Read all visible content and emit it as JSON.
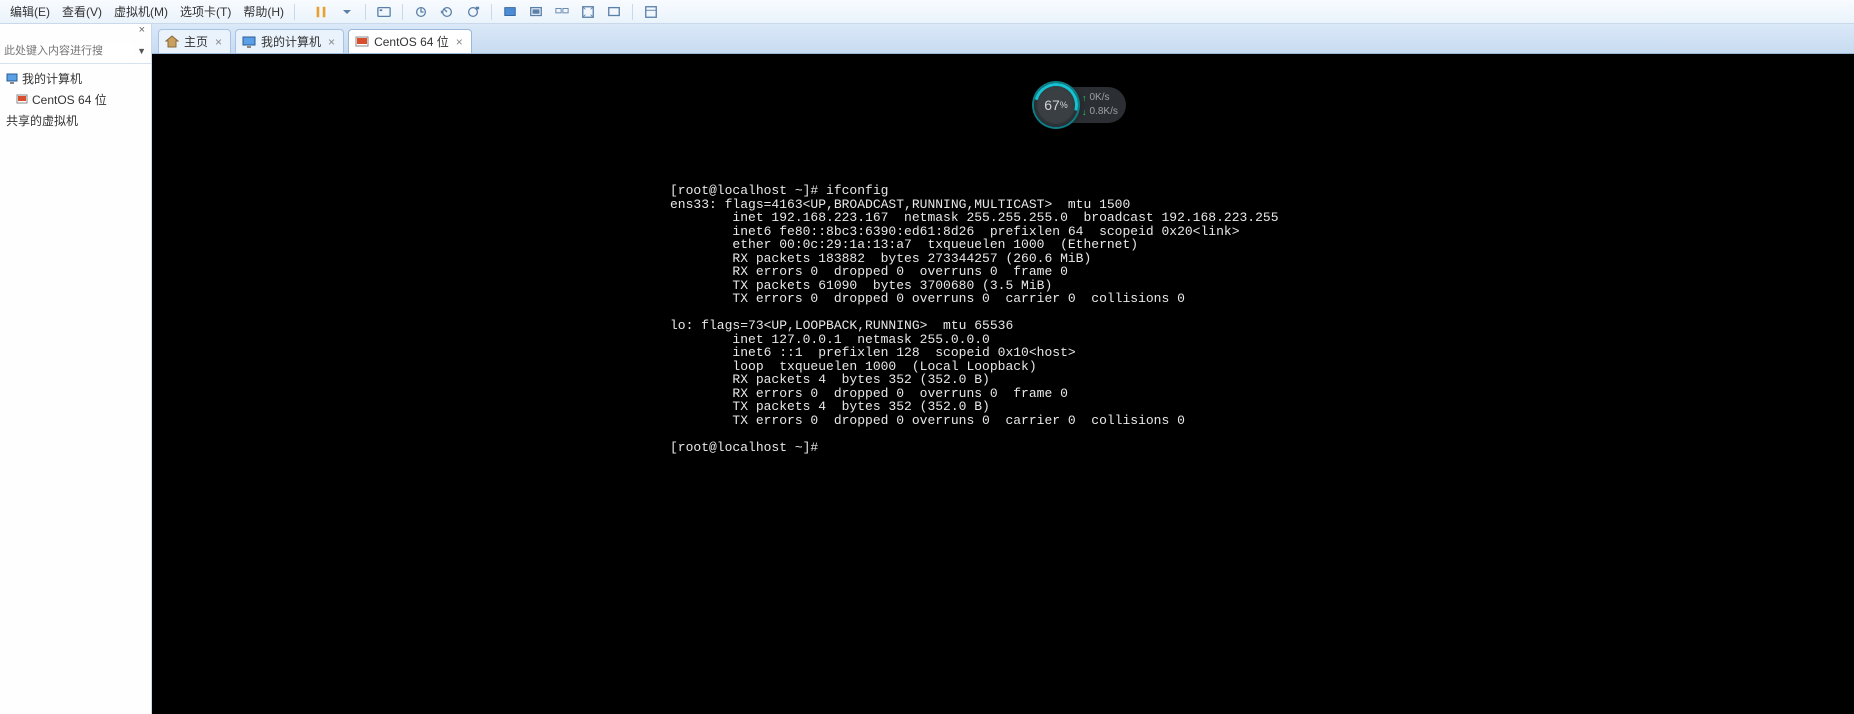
{
  "menu": {
    "edit": "编辑(E)",
    "view": "查看(V)",
    "vm": "虚拟机(M)",
    "tabs": "选项卡(T)",
    "help": "帮助(H)"
  },
  "sidebar": {
    "close_x": "×",
    "search_placeholder": "此处键入内容进行搜",
    "items": {
      "my_computer": "我的计算机",
      "centos": "CentOS 64 位",
      "shared": "共享的虚拟机"
    }
  },
  "tabs": [
    {
      "label": "主页",
      "icon": "home"
    },
    {
      "label": "我的计算机",
      "icon": "monitor"
    },
    {
      "label": "CentOS 64 位",
      "icon": "vm",
      "active": true
    }
  ],
  "perf": {
    "percent": "67",
    "pct_sym": "%",
    "up": "0K/s",
    "down": "0.8K/s"
  },
  "terminal": {
    "lines": [
      "[root@localhost ~]# ifconfig",
      "ens33: flags=4163<UP,BROADCAST,RUNNING,MULTICAST>  mtu 1500",
      "        inet 192.168.223.167  netmask 255.255.255.0  broadcast 192.168.223.255",
      "        inet6 fe80::8bc3:6390:ed61:8d26  prefixlen 64  scopeid 0x20<link>",
      "        ether 00:0c:29:1a:13:a7  txqueuelen 1000  (Ethernet)",
      "        RX packets 183882  bytes 273344257 (260.6 MiB)",
      "        RX errors 0  dropped 0  overruns 0  frame 0",
      "        TX packets 61090  bytes 3700680 (3.5 MiB)",
      "        TX errors 0  dropped 0 overruns 0  carrier 0  collisions 0",
      "",
      "lo: flags=73<UP,LOOPBACK,RUNNING>  mtu 65536",
      "        inet 127.0.0.1  netmask 255.0.0.0",
      "        inet6 ::1  prefixlen 128  scopeid 0x10<host>",
      "        loop  txqueuelen 1000  (Local Loopback)",
      "        RX packets 4  bytes 352 (352.0 B)",
      "        RX errors 0  dropped 0  overruns 0  frame 0",
      "        TX packets 4  bytes 352 (352.0 B)",
      "        TX errors 0  dropped 0 overruns 0  carrier 0  collisions 0",
      "",
      "[root@localhost ~]#"
    ]
  }
}
